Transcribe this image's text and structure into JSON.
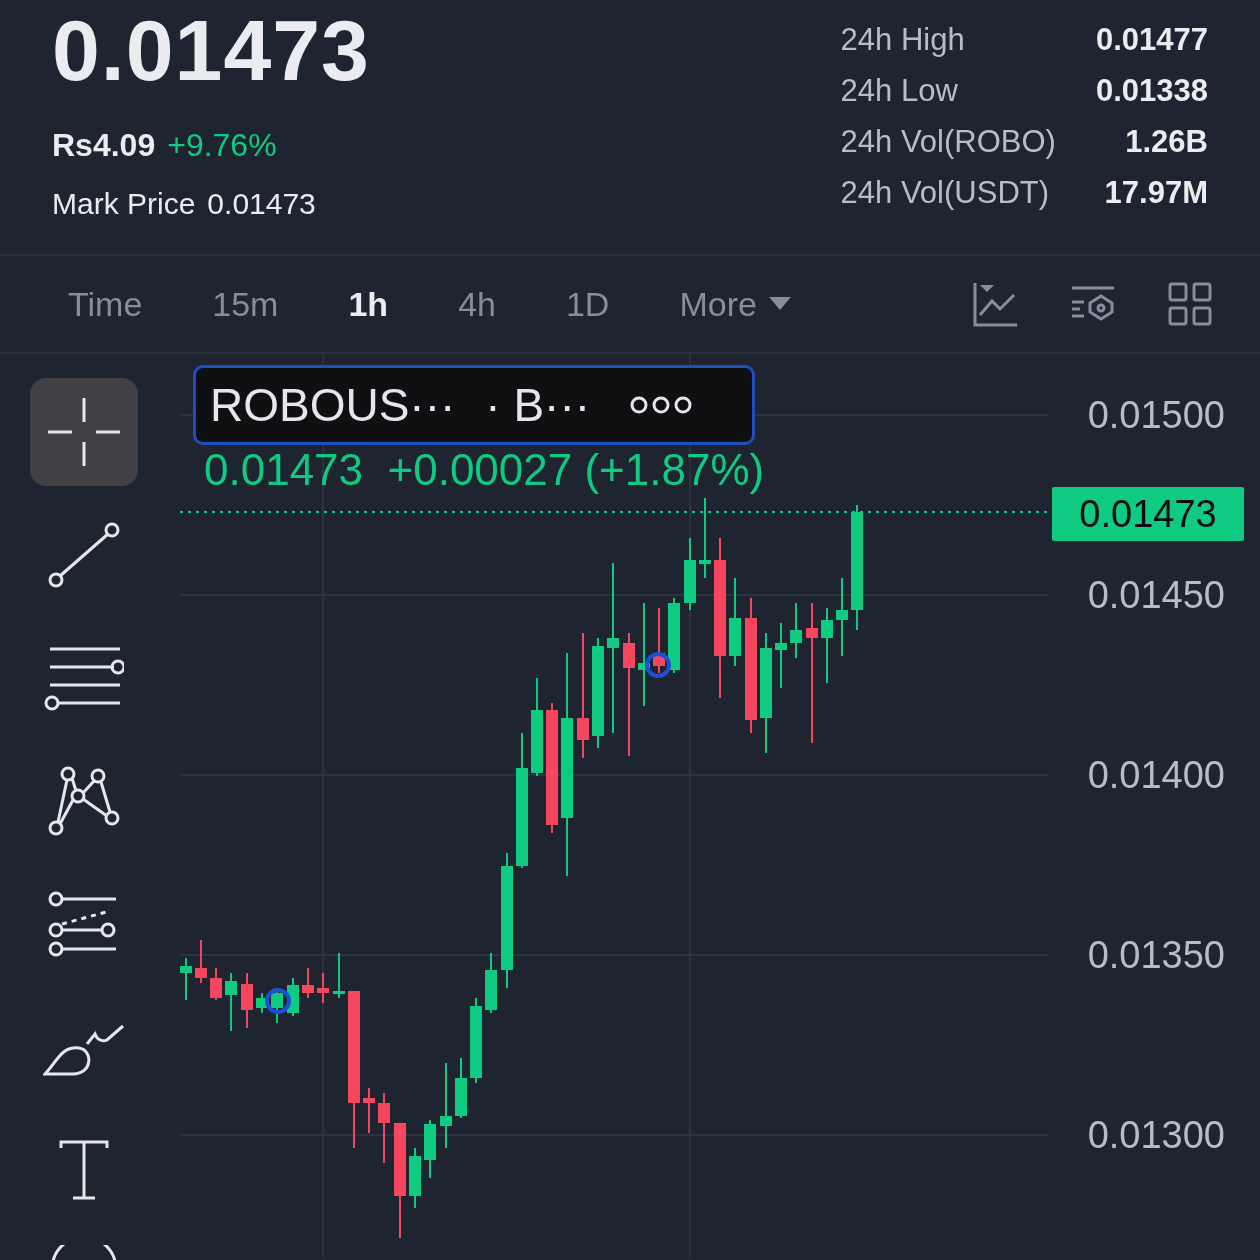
{
  "ticker": {
    "last_price": "0.01473",
    "fiat_price": "Rs4.09",
    "change_percent": "+9.76%",
    "mark_price_label": "Mark Price",
    "mark_price": "0.01473"
  },
  "stats": [
    {
      "label": "24h High",
      "value": "0.01477"
    },
    {
      "label": "24h Low",
      "value": "0.01338"
    },
    {
      "label": "24h Vol(ROBO)",
      "value": "1.26B"
    },
    {
      "label": "24h Vol(USDT)",
      "value": "17.97M"
    }
  ],
  "intervals": [
    {
      "label": "Time",
      "selected": false
    },
    {
      "label": "15m",
      "selected": false
    },
    {
      "label": "1h",
      "selected": true
    },
    {
      "label": "4h",
      "selected": false
    },
    {
      "label": "1D",
      "selected": false
    }
  ],
  "more_menu": {
    "label": "More"
  },
  "drawing_tools": [
    {
      "kind": "crosshair",
      "selected": true
    },
    {
      "kind": "line",
      "selected": false
    },
    {
      "kind": "parallel",
      "selected": false
    },
    {
      "kind": "pattern",
      "selected": false
    },
    {
      "kind": "fib",
      "selected": false
    },
    {
      "kind": "brush",
      "selected": false
    },
    {
      "kind": "text",
      "selected": false
    },
    {
      "kind": "shape",
      "selected": false
    }
  ],
  "chart": {
    "legend": {
      "symbol": "ROBOUS···",
      "exchange": "· B···"
    },
    "quote": "0.01473  +0.00027 (+1.87%)",
    "price_axis": [
      "0.01500",
      "0.01450",
      "0.01400",
      "0.01350",
      "0.01300"
    ],
    "current_price": "0.01473"
  }
}
